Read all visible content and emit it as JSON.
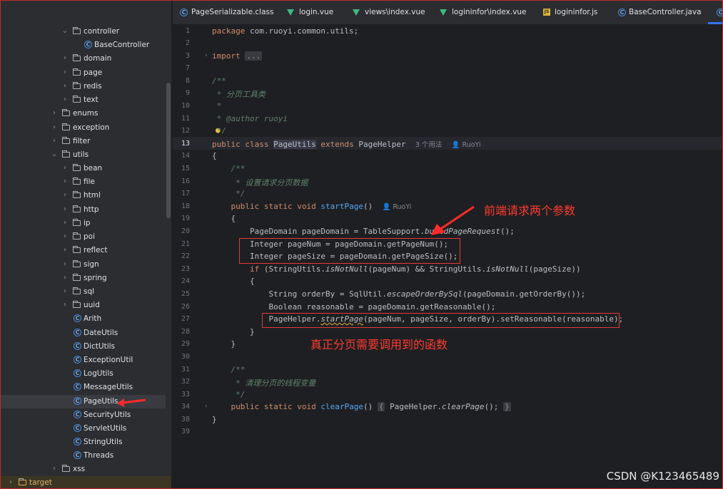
{
  "tabs": [
    {
      "label": "PageSerializable.class",
      "icon": "class-icon"
    },
    {
      "label": "login.vue",
      "icon": "vue-icon"
    },
    {
      "label": "views\\index.vue",
      "icon": "vue-icon"
    },
    {
      "label": "logininfor\\index.vue",
      "icon": "vue-icon"
    },
    {
      "label": "logininfor.js",
      "icon": "js-icon"
    },
    {
      "label": "BaseController.java",
      "icon": "class-icon"
    }
  ],
  "tree": [
    {
      "label": "controller",
      "type": "folder",
      "expanded": true
    },
    {
      "label": "BaseController",
      "type": "class"
    },
    {
      "label": "domain",
      "type": "folder"
    },
    {
      "label": "page",
      "type": "folder"
    },
    {
      "label": "redis",
      "type": "folder"
    },
    {
      "label": "text",
      "type": "folder"
    },
    {
      "label": "enums",
      "type": "folder"
    },
    {
      "label": "exception",
      "type": "folder"
    },
    {
      "label": "filter",
      "type": "folder"
    },
    {
      "label": "utils",
      "type": "folder",
      "expanded": true
    },
    {
      "label": "bean",
      "type": "folder"
    },
    {
      "label": "file",
      "type": "folder"
    },
    {
      "label": "html",
      "type": "folder"
    },
    {
      "label": "http",
      "type": "folder"
    },
    {
      "label": "ip",
      "type": "folder"
    },
    {
      "label": "poi",
      "type": "folder"
    },
    {
      "label": "reflect",
      "type": "folder"
    },
    {
      "label": "sign",
      "type": "folder"
    },
    {
      "label": "spring",
      "type": "folder"
    },
    {
      "label": "sql",
      "type": "folder"
    },
    {
      "label": "uuid",
      "type": "folder"
    },
    {
      "label": "Arith",
      "type": "class"
    },
    {
      "label": "DateUtils",
      "type": "class"
    },
    {
      "label": "DictUtils",
      "type": "class"
    },
    {
      "label": "ExceptionUtil",
      "type": "class"
    },
    {
      "label": "LogUtils",
      "type": "class"
    },
    {
      "label": "MessageUtils",
      "type": "class"
    },
    {
      "label": "PageUtils",
      "type": "class",
      "selected": true
    },
    {
      "label": "SecurityUtils",
      "type": "class"
    },
    {
      "label": "ServletUtils",
      "type": "class"
    },
    {
      "label": "StringUtils",
      "type": "class"
    },
    {
      "label": "Threads",
      "type": "class"
    },
    {
      "label": "xss",
      "type": "folder"
    },
    {
      "label": "target",
      "type": "folder"
    }
  ],
  "line_numbers": [
    "1",
    "2",
    "3",
    "7",
    "8",
    "9",
    "10",
    "11",
    "12",
    "13",
    "14",
    "15",
    "16",
    "17",
    "18",
    "19",
    "20",
    "21",
    "22",
    "23",
    "24",
    "25",
    "26",
    "27",
    "28",
    "29",
    "30",
    "31",
    "32",
    "33",
    "34",
    "38",
    "39"
  ],
  "code": {
    "package_kw": "package",
    "package_name": " com.ruoyi.common.utils;",
    "import_kw": "import",
    "import_fold": "...",
    "doc_open": "/**",
    "doc_desc": " * 分页工具类",
    "doc_star": " *",
    "doc_author": " * @author ruoyi",
    "doc_close": " */",
    "public_kw": "public",
    "class_kw": "class",
    "class_name": "PageUtils",
    "extends_kw": "extends",
    "super_name": "PageHelper",
    "usages_hint": "3 个用法",
    "author_hint": "RuoYi",
    "brace_open": "{",
    "brace_close": "}",
    "m1_doc_open": "/**",
    "m1_doc_desc": " * 设置请求分页数据",
    "m1_doc_close": " */",
    "static_void": "static void",
    "m1_name": "startPage",
    "m1_parens": "()",
    "m1_author_hint": "RuoYi",
    "l20_a": "PageDomain pageDomain = TableSupport.",
    "l20_b": "buildPageRequest",
    "l20_c": "();",
    "l21": "Integer pageNum = pageDomain.getPageNum();",
    "l22": "Integer pageSize = pageDomain.getPageSize();",
    "l23_if": "if",
    "l23_a": " (StringUtils.",
    "l23_b": "isNotNull",
    "l23_c": "(pageNum) && StringUtils.",
    "l23_d": "isNotNull",
    "l23_e": "(pageSize))",
    "l25_a": "String orderBy = SqlUtil.",
    "l25_b": "escapeOrderBySql",
    "l25_c": "(pageDomain.getOrderBy());",
    "l26": "Boolean reasonable = pageDomain.getReasonable();",
    "l27_a": "PageHelper.",
    "l27_b": "startPage",
    "l27_c": "(pageNum, pageSize, orderBy).setReasonable(reasonable);",
    "m2_doc_open": "/**",
    "m2_doc_desc": " * 清理分页的线程变量",
    "m2_doc_close": " */",
    "m2_name": "clearPage",
    "m2_parens": "()",
    "m2_body_a": " PageHelper.",
    "m2_body_b": "clearPage",
    "m2_body_c": "(); "
  },
  "annotations": {
    "params_note": "前端请求两个参数",
    "call_note": "真正分页需要调用到的函数"
  },
  "watermark": "CSDN @K123465489",
  "colors": {
    "keyword": "#cf8e6d",
    "function": "#56a8f5",
    "comment": "#5f826b",
    "annotation": "#ff3b30",
    "accent": "#3574f0"
  }
}
